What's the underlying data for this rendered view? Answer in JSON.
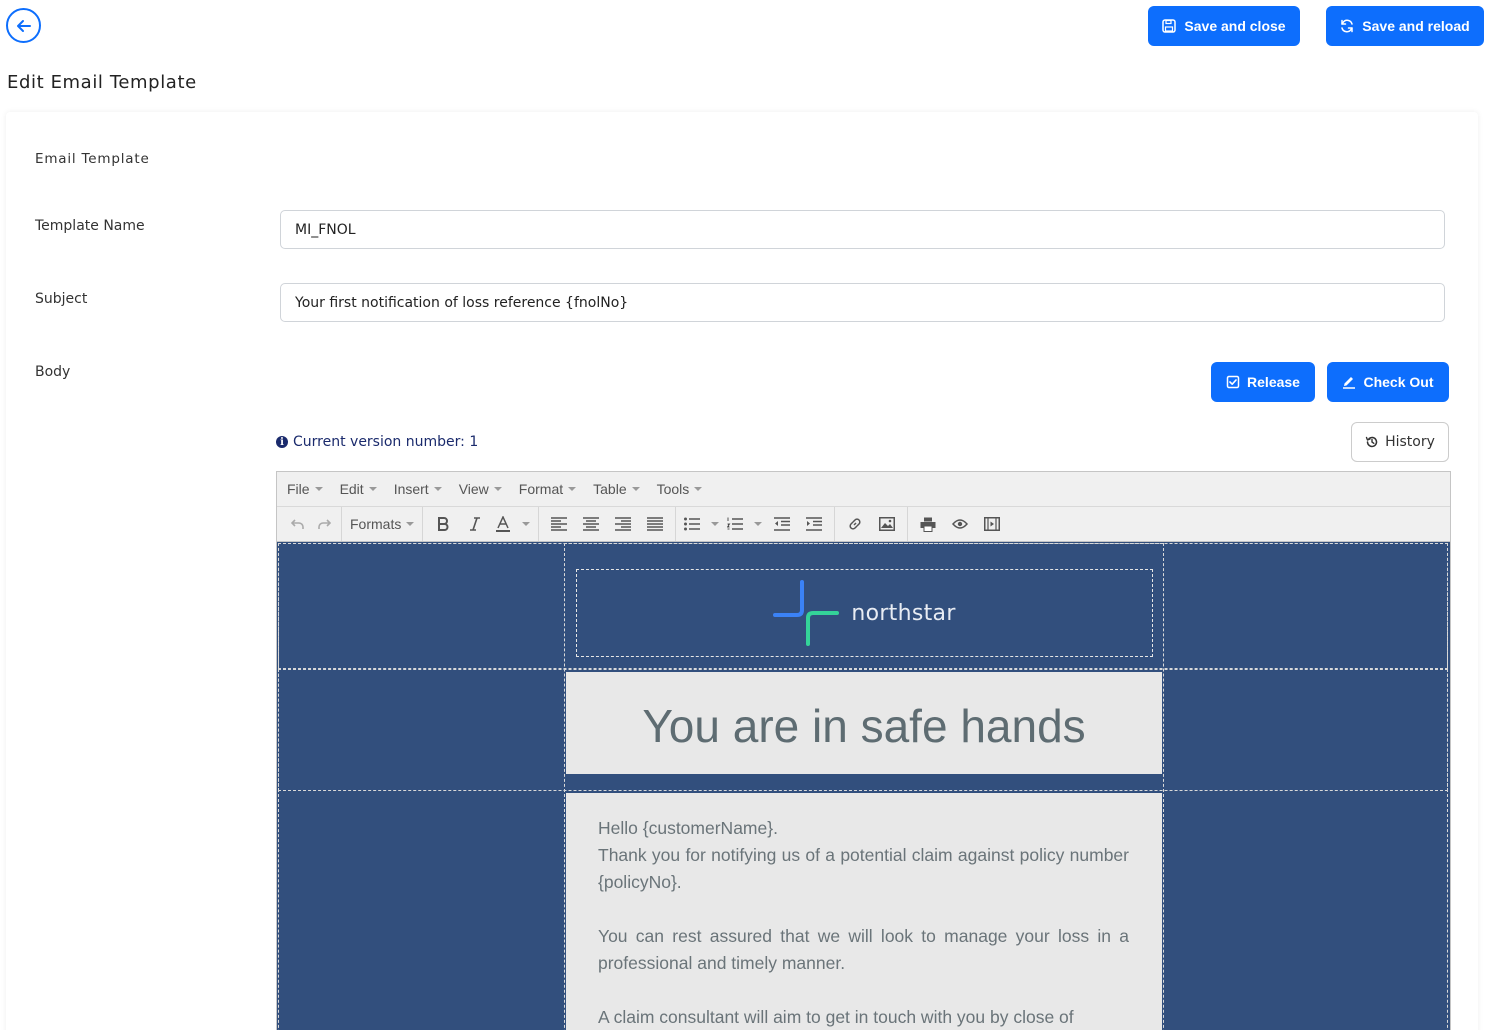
{
  "header": {
    "save_close_label": "Save and close",
    "save_reload_label": "Save and reload",
    "page_title": "Edit Email Template"
  },
  "form": {
    "section_title": "Email Template",
    "template_name_label": "Template Name",
    "template_name_value": "MI_FNOL",
    "subject_label": "Subject",
    "subject_value": "Your first notification of loss reference {fnolNo}",
    "body_label": "Body",
    "release_label": "Release",
    "checkout_label": "Check Out",
    "version_text": "Current version number: 1",
    "history_label": "History"
  },
  "editor": {
    "menus": [
      "File",
      "Edit",
      "Insert",
      "View",
      "Format",
      "Table",
      "Tools"
    ],
    "formats_label": "Formats"
  },
  "email": {
    "logo_text": "northstar",
    "hero_title": "You are in safe hands",
    "paragraphs": [
      "Hello {customerName}.",
      "Thank you for notifying us of a potential claim against policy number {policyNo}.",
      "You can rest assured that we will look to manage your loss in a professional and timely manner.",
      "A claim consultant will aim to get in touch with you by close of"
    ]
  },
  "colors": {
    "primary": "#0d6efd",
    "email_background": "#324f7d",
    "email_panel": "#e8e8e8",
    "version_text": "#1a2a6c",
    "logo_blue": "#3b82f6",
    "logo_green": "#34d399"
  }
}
